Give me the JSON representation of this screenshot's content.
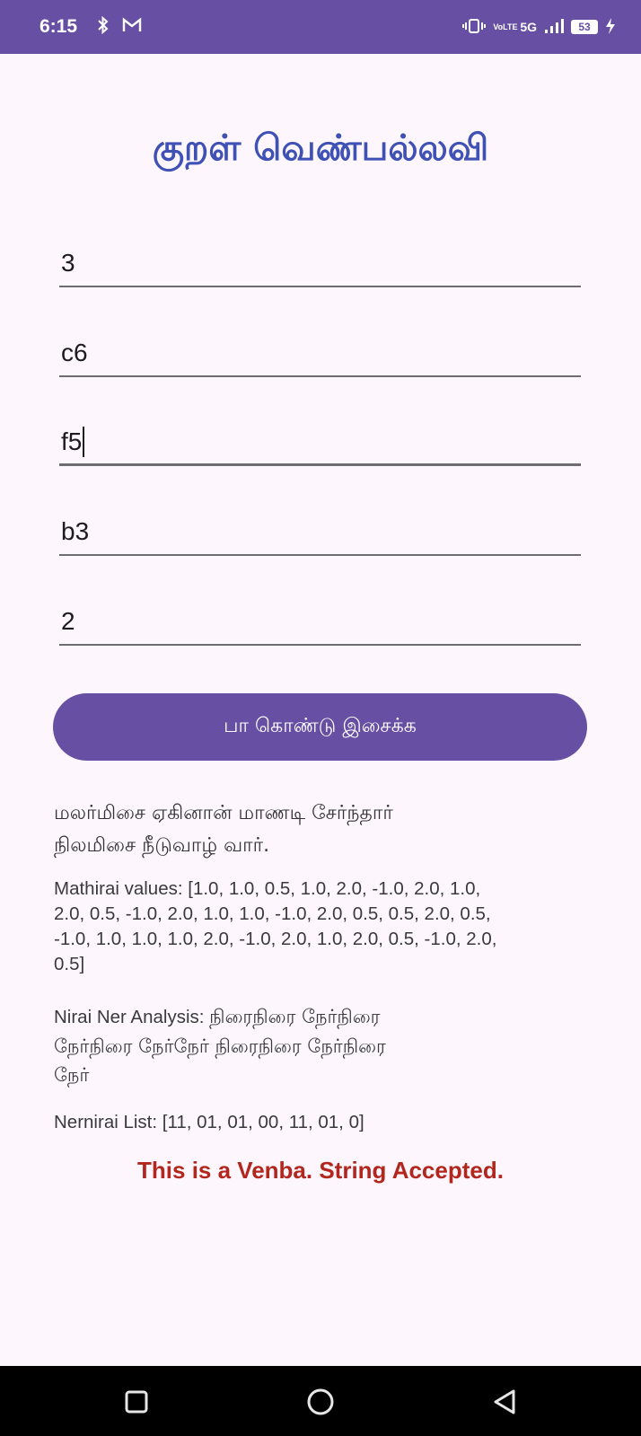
{
  "status_bar": {
    "time": "6:15",
    "left_icons": [
      "bluetooth-icon",
      "gmail-icon"
    ],
    "network_label": "5G",
    "volte_label": "VoLTE",
    "battery_level": "53",
    "color": "#6750a4"
  },
  "app": {
    "title": "குறள் வெண்பல்லவி",
    "title_color": "#3f51b5"
  },
  "inputs": [
    {
      "value": "3"
    },
    {
      "value": "c6"
    },
    {
      "value": "f5",
      "focused": true
    },
    {
      "value": "b3"
    },
    {
      "value": "2"
    }
  ],
  "play_button": {
    "label": "பா கொண்டு இசைக்க",
    "color": "#6750a4"
  },
  "output": {
    "kural_line1": "மலர்மிசை ஏகினான் மாணடி சேர்ந்தார்",
    "kural_line2": "நிலமிசை நீடுவாழ் வார்.",
    "mathirai_l1": "Mathirai values: [1.0, 1.0, 0.5, 1.0, 2.0, -1.0, 2.0, 1.0,",
    "mathirai_l2": "2.0, 0.5, -1.0, 2.0, 1.0, 1.0, -1.0, 2.0, 0.5, 0.5, 2.0, 0.5,",
    "mathirai_l3": "-1.0, 1.0, 1.0, 1.0, 2.0, -1.0, 2.0, 1.0, 2.0, 0.5, -1.0, 2.0,",
    "mathirai_l4": "0.5]",
    "analysis_label": "Nirai Ner Analysis: ",
    "analysis_l1": "நிரைநிரை நேர்நிரை",
    "analysis_l2": "நேர்நிரை நேர்நேர் நிரைநிரை நேர்நிரை",
    "analysis_l3": "நேர்",
    "nernirai": "Nernirai List: [11, 01, 01, 00, 11, 01, 0]",
    "verdict": "This is a Venba. String Accepted.",
    "verdict_color": "#b3261e"
  },
  "nav_bar": {
    "buttons": [
      "recents-icon",
      "home-icon",
      "back-icon"
    ]
  }
}
